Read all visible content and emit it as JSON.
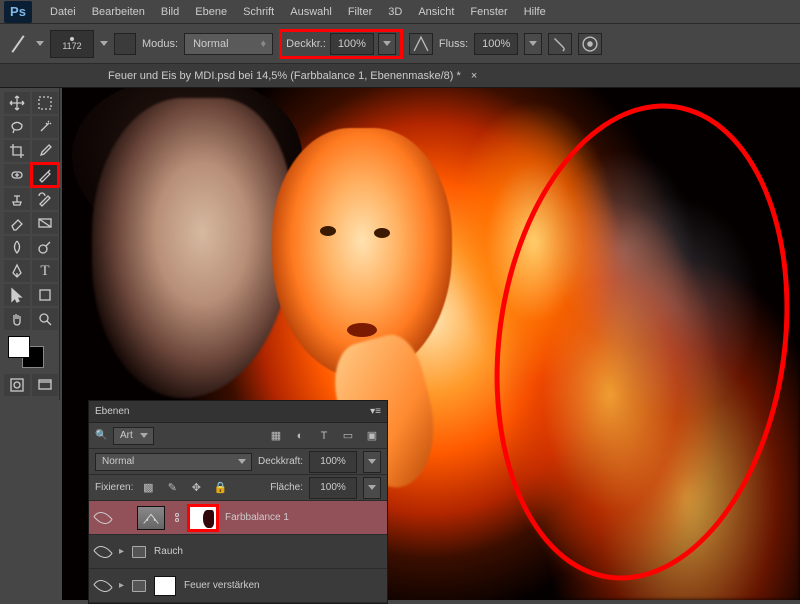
{
  "app": {
    "logo": "Ps"
  },
  "menu": [
    "Datei",
    "Bearbeiten",
    "Bild",
    "Ebene",
    "Schrift",
    "Auswahl",
    "Filter",
    "3D",
    "Ansicht",
    "Fenster",
    "Hilfe"
  ],
  "options": {
    "brush_size": "1172",
    "mode_label": "Modus:",
    "mode_value": "Normal",
    "opacity_label": "Deckkr.:",
    "opacity_value": "100%",
    "flow_label": "Fluss:",
    "flow_value": "100%"
  },
  "document": {
    "title": "Feuer und Eis by MDI.psd bei 14,5% (Farbbalance 1, Ebenenmaske/8) *",
    "close": "×"
  },
  "layers_panel": {
    "title": "Ebenen",
    "filter_label": "Art",
    "blend_mode": "Normal",
    "opacity_label": "Deckkraft:",
    "opacity_value": "100%",
    "lock_label": "Fixieren:",
    "fill_label": "Fläche:",
    "fill_value": "100%",
    "layers": [
      {
        "name": "Farbbalance 1"
      },
      {
        "name": "Rauch"
      },
      {
        "name": "Feuer verstärken"
      }
    ]
  }
}
